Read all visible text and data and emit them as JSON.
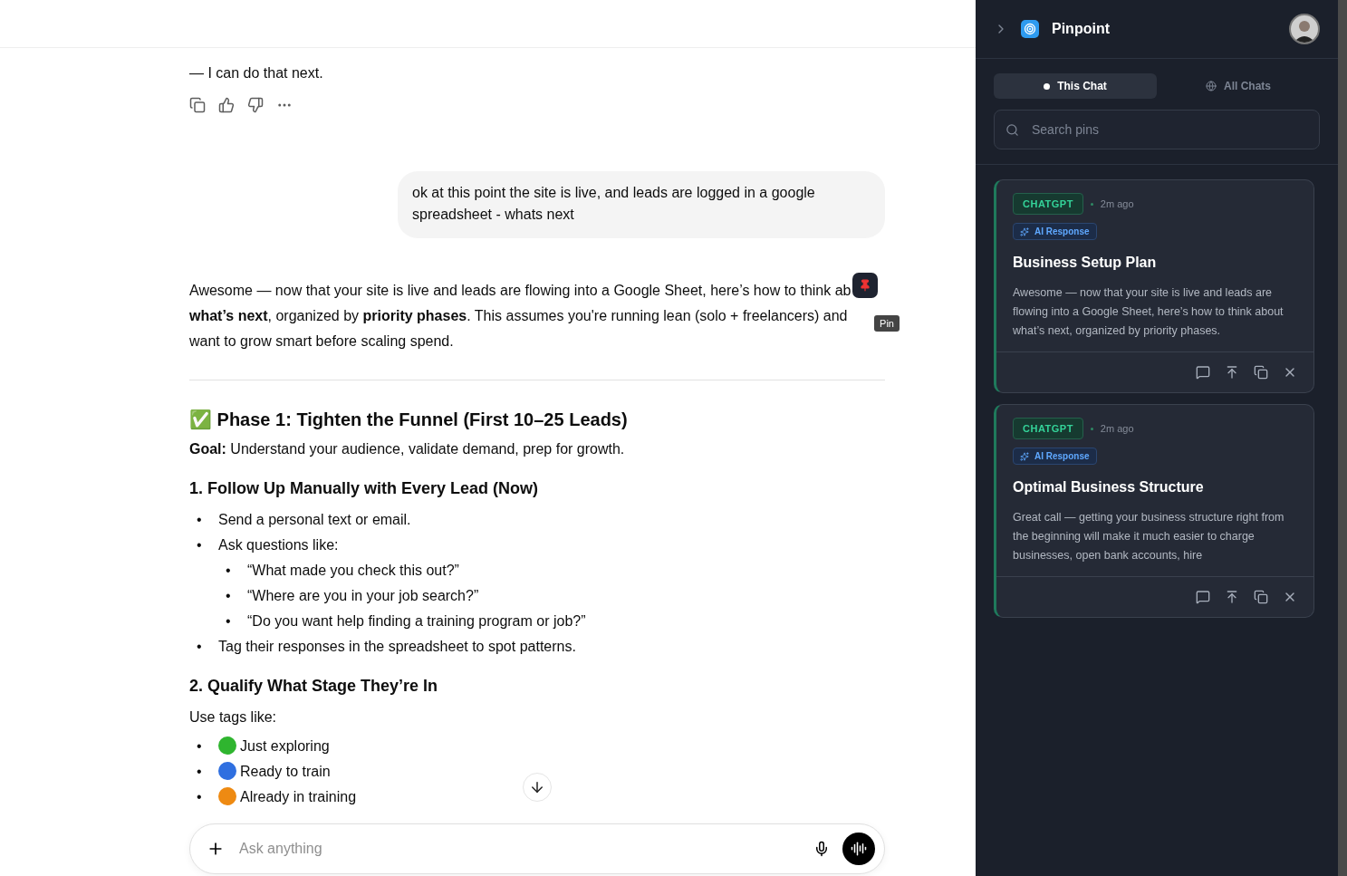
{
  "chat": {
    "previous_reply_end": "— I can do that next.",
    "user_message": "ok at this point the site is live, and leads are logged in a google spreadsheet - whats next",
    "intro": "Awesome — now that your site is live and leads are flowing into a Google Sheet, here’s how to think ab **what’s next**, organized by **priority phases**. This assumes you're running lean (solo + freelancers) and want to grow smart before scaling spend.",
    "pin_tooltip": "Pin",
    "phase_heading": "✅ Phase 1: Tighten the Funnel (First 10–25 Leads)",
    "goal": "**Goal:** Understand your audience, validate demand, prep for growth.",
    "sections": [
      {
        "heading": "1. Follow Up Manually with Every Lead (Now)",
        "bullets": [
          {
            "marker": "•",
            "text": "Send a personal text or email."
          },
          {
            "marker": "•",
            "text": "Ask questions like:",
            "children": [
              {
                "marker": "•",
                "text": "“What made you check this out?”"
              },
              {
                "marker": "•",
                "text": "“Where are you in your job search?”"
              },
              {
                "marker": "•",
                "text": "“Do you want help finding a training program or job?”"
              }
            ]
          },
          {
            "marker": "•",
            "text": "Tag their responses in the spreadsheet to spot patterns."
          }
        ]
      },
      {
        "heading": "2. Qualify What Stage They’re In",
        "intro": "Use tags like:",
        "tags": [
          {
            "marker": "•",
            "text": "Just exploring",
            "color": "#2fb52f"
          },
          {
            "marker": "•",
            "text": "Ready to train",
            "color": "#2f6fe0"
          },
          {
            "marker": "•",
            "text": "Already in training",
            "color": "#ee8a12"
          }
        ]
      }
    ],
    "composer": {
      "placeholder": "Ask anything"
    }
  },
  "sidebar": {
    "title": "Pinpoint",
    "tabs": [
      {
        "label": "This Chat",
        "selected": true
      },
      {
        "label": "All Chats",
        "selected": false
      }
    ],
    "search": {
      "placeholder": "Search pins"
    },
    "pins": [
      {
        "source": "CHATGPT",
        "time": "2m ago",
        "type": "AI Response",
        "title": "Business Setup Plan",
        "preview": "Awesome — now that your site is live and leads are flowing into a Google Sheet, here’s how to think about what’s next, organized by priority phases."
      },
      {
        "source": "CHATGPT",
        "time": "2m ago",
        "type": "AI Response",
        "title": "Optimal Business Structure",
        "preview": "Great call — getting your business structure right from the beginning will make it much easier to charge businesses, open bank accounts, hire"
      }
    ]
  }
}
